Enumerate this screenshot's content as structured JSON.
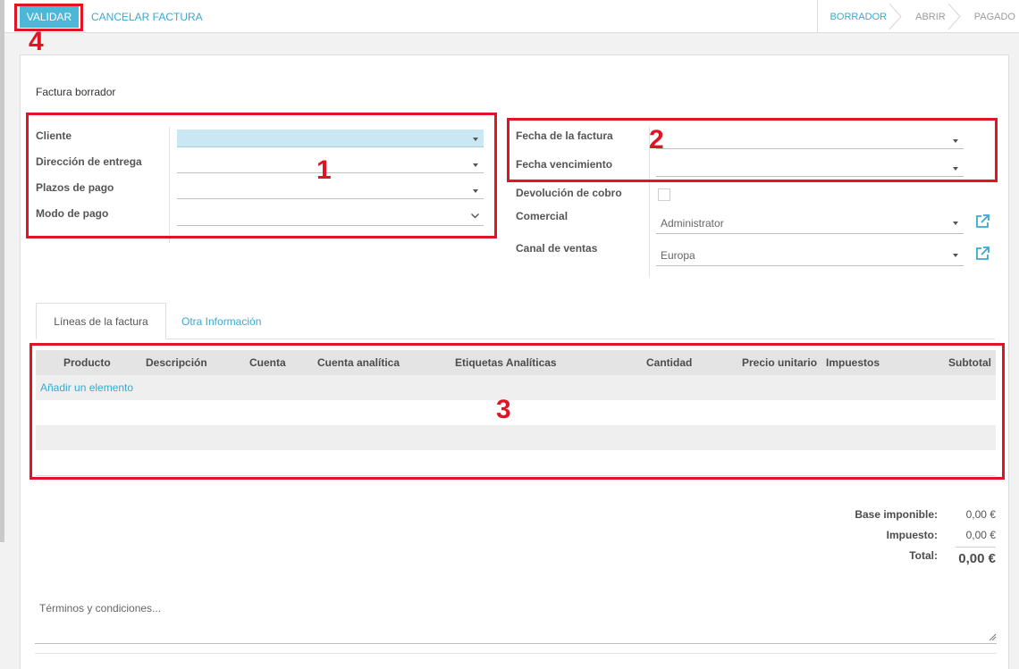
{
  "toolbar": {
    "validate_label": "VALIDAR",
    "cancel_label": "CANCELAR FACTURA"
  },
  "statusbar": {
    "steps": [
      {
        "label": "BORRADOR",
        "active": true
      },
      {
        "label": "ABRIR",
        "active": false
      },
      {
        "label": "PAGADO",
        "active": false
      }
    ]
  },
  "form": {
    "title": "Factura borrador",
    "left_fields": [
      {
        "label": "Cliente",
        "value": ""
      },
      {
        "label": "Dirección de entrega",
        "value": ""
      },
      {
        "label": "Plazos de pago",
        "value": ""
      },
      {
        "label": "Modo de pago",
        "value": ""
      }
    ],
    "right_fields": {
      "invoice_date": {
        "label": "Fecha de la factura",
        "value": ""
      },
      "due_date": {
        "label": "Fecha vencimiento",
        "value": ""
      },
      "refund": {
        "label": "Devolución de cobro",
        "checked": false
      },
      "salesperson": {
        "label": "Comercial",
        "value": "Administrator"
      },
      "sales_channel": {
        "label": "Canal de ventas",
        "value": "Europa"
      }
    }
  },
  "tabs": [
    {
      "label": "Líneas de la factura",
      "active": true
    },
    {
      "label": "Otra Información",
      "active": false
    }
  ],
  "lines_table": {
    "columns": [
      "Producto",
      "Descripción",
      "Cuenta",
      "Cuenta analítica",
      "Etiquetas Analíticas",
      "Cantidad",
      "Precio unitario",
      "Impuestos",
      "Subtotal"
    ],
    "add_item_label": "Añadir un elemento",
    "rows": []
  },
  "totals": {
    "base_label": "Base imponible:",
    "base_value": "0,00 €",
    "tax_label": "Impuesto:",
    "tax_value": "0,00 €",
    "total_label": "Total:",
    "total_value": "0,00 €"
  },
  "notes": {
    "placeholder": "Términos y condiciones..."
  },
  "annotations": {
    "box1": "1",
    "box2": "2",
    "box3": "3",
    "box4": "4",
    "color": "#e11425"
  },
  "colors": {
    "accent": "#4db7d8",
    "link": "#3aa8cf",
    "active_field": "#c9e8f3"
  },
  "icons": {
    "dropdown": "caret-down-icon",
    "select": "chevron-down-icon",
    "external": "external-link-icon",
    "status_separator": "chevron-right-icon",
    "resize": "resize-grip-icon"
  }
}
